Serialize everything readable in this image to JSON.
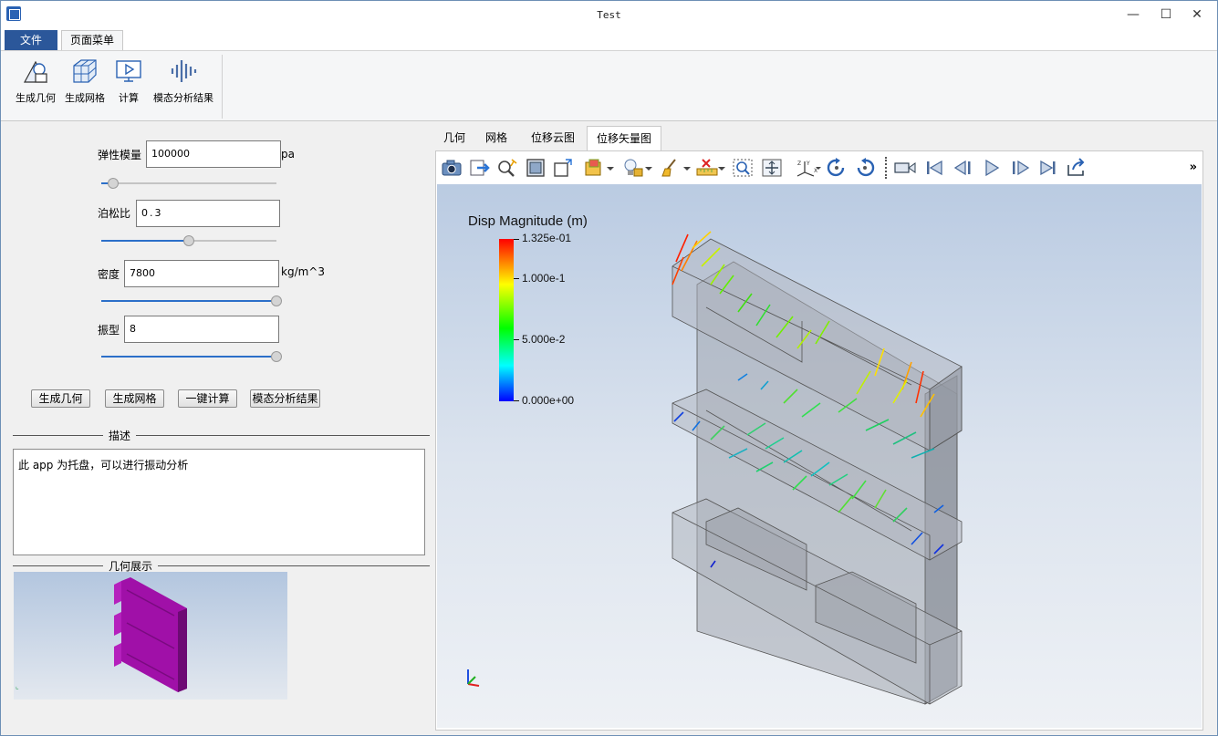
{
  "window": {
    "title": "Test",
    "minimize": "—",
    "maximize": "☐",
    "close": "✕"
  },
  "menu": {
    "tabs": [
      "文件",
      "页面菜单"
    ]
  },
  "ribbon": {
    "buttons": [
      "生成几何",
      "生成网格",
      "计算",
      "模态分析结果"
    ]
  },
  "params": {
    "elastic": {
      "label": "弹性模量",
      "value": "100000",
      "unit": "pa",
      "slider": 0.07
    },
    "poisson": {
      "label": "泊松比",
      "value": "0.3",
      "slider": 0.5
    },
    "density": {
      "label": "密度",
      "value": "7800",
      "unit": "kg/m^3",
      "slider": 1.0
    },
    "mode": {
      "label": "振型",
      "value": "8",
      "slider": 1.0
    }
  },
  "actions": [
    "生成几何",
    "生成网格",
    "一键计算",
    "模态分析结果"
  ],
  "description": {
    "title": "描述",
    "text": "此 app 为托盘，可以进行振动分析"
  },
  "geometry_preview": {
    "title": "几何展示"
  },
  "viewer": {
    "tabs": [
      "几何",
      "网格",
      "位移云图",
      "位移矢量图"
    ],
    "active_tab": 3,
    "toolbar_icons": [
      "camera-icon",
      "export-icon",
      "zoom-pick-icon",
      "fit-view-icon",
      "box-view-icon",
      "display-mode-icon",
      "light-icon",
      "brush-icon",
      "ruler-icon",
      "zoom-box-icon",
      "center-icon",
      "axes-icon",
      "rotate-cw-icon",
      "rotate-ccw-icon",
      "video-camera-icon",
      "first-frame-icon",
      "prev-frame-icon",
      "play-icon",
      "next-frame-icon",
      "last-frame-icon",
      "export-animation-icon"
    ],
    "more": "»",
    "legend": {
      "title": "Disp Magnitude (m)",
      "ticks": [
        "1.325e-01",
        "1.000e-1",
        "5.000e-2",
        "0.000e+00"
      ],
      "colors": [
        "#ff0000",
        "#ffff00",
        "#00ff00",
        "#00ffff",
        "#0000ff"
      ]
    }
  }
}
